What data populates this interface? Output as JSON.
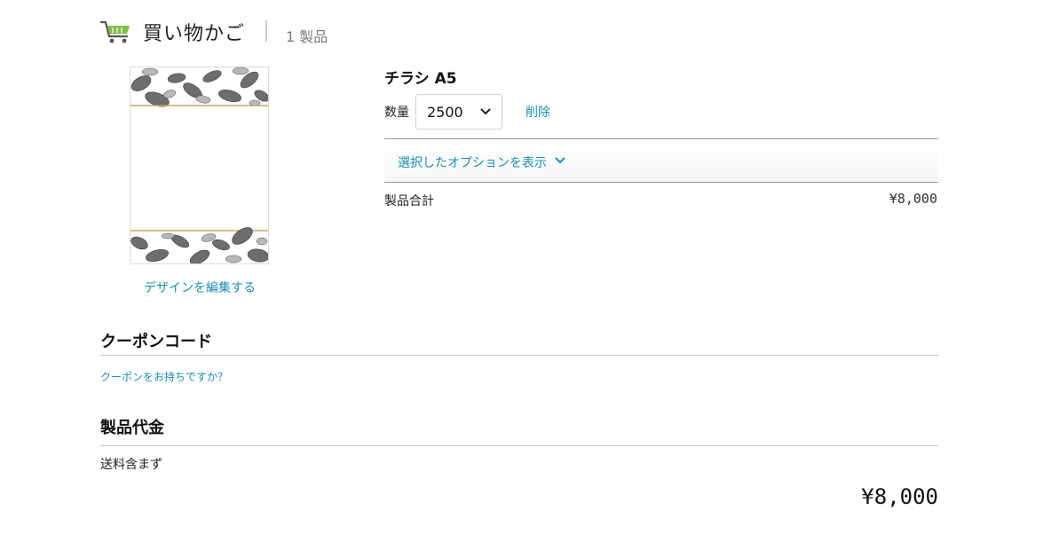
{
  "header": {
    "title": "買い物かご",
    "item_count": "1 製品",
    "cart_icon": "shopping-cart-icon"
  },
  "product": {
    "name": "チラシ A5",
    "quantity_label": "数量",
    "quantity_value": "2500",
    "remove_label": "削除",
    "edit_design_label": "デザインを編集する",
    "options_toggle_label": "選択したオプションを表示",
    "subtotal_label": "製品合計",
    "subtotal_value": "¥8,000"
  },
  "coupon": {
    "heading": "クーポンコード",
    "link": "クーポンをお持ちですか？"
  },
  "total": {
    "heading": "製品代金",
    "shipping_note": "送料含まず",
    "amount": "¥8,000"
  },
  "colors": {
    "link": "#1a8fb3",
    "cart_accent": "#7bc043",
    "gold_line": "#c9a85c"
  }
}
